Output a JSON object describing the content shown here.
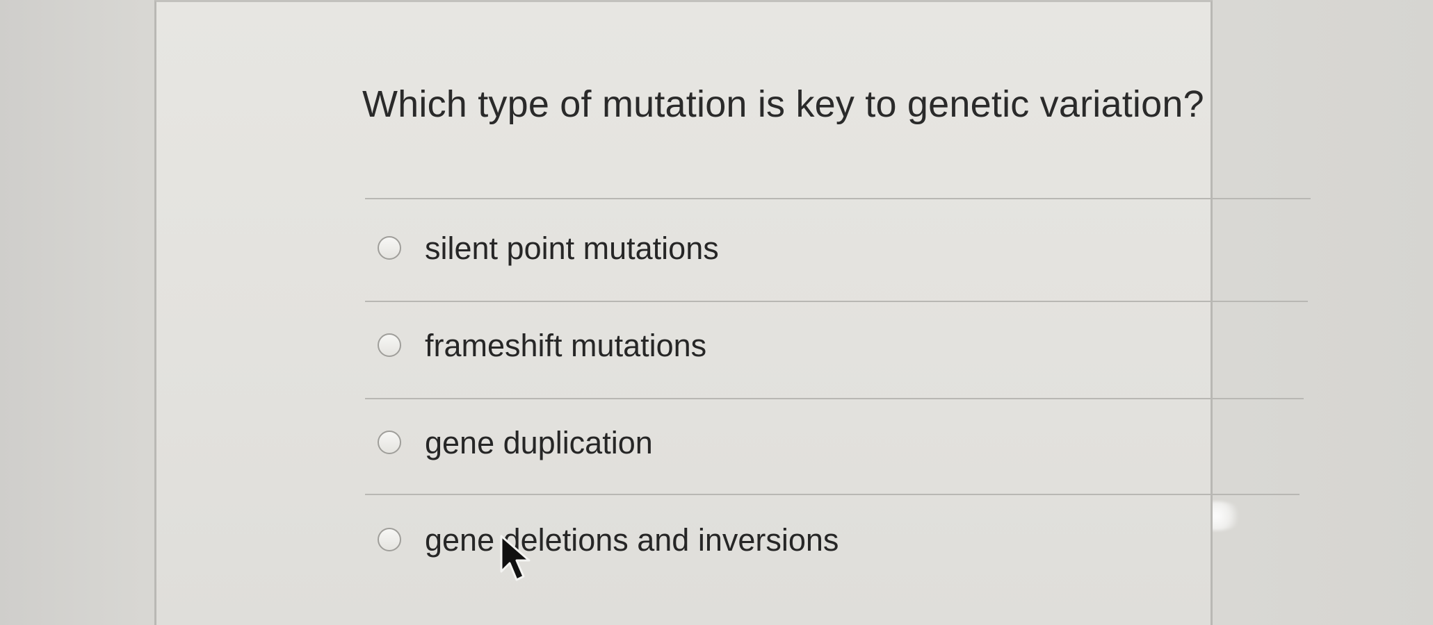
{
  "question": {
    "text": "Which type of mutation is key to genetic variation?"
  },
  "answers": [
    {
      "label": "silent point mutations"
    },
    {
      "label": "frameshift mutations"
    },
    {
      "label": "gene duplication"
    },
    {
      "label": "gene deletions and inversions"
    }
  ],
  "icons": {
    "radio": "radio-button-icon",
    "cursor": "mouse-pointer-icon"
  },
  "colors": {
    "background": "#d8d7d3",
    "card": "#e5e4e0",
    "text": "#262626",
    "rule": "#b8b7b3"
  }
}
